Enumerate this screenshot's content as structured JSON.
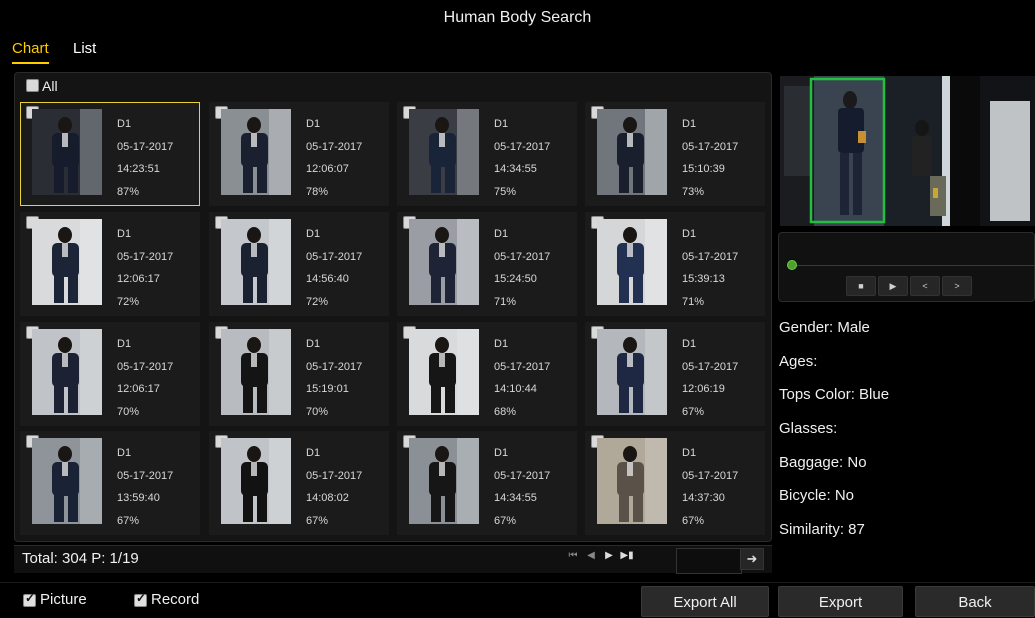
{
  "window": {
    "title": "Human Body Search"
  },
  "tabs": [
    {
      "label": "Chart",
      "active": true
    },
    {
      "label": "List",
      "active": false
    }
  ],
  "grid": {
    "select_all_label": "All",
    "results": [
      {
        "channel": "D1",
        "date": "05-17-2017",
        "time": "14:23:51",
        "score": "87%",
        "selected": true
      },
      {
        "channel": "D1",
        "date": "05-17-2017",
        "time": "12:06:07",
        "score": "78%"
      },
      {
        "channel": "D1",
        "date": "05-17-2017",
        "time": "14:34:55",
        "score": "75%"
      },
      {
        "channel": "D1",
        "date": "05-17-2017",
        "time": "15:10:39",
        "score": "73%"
      },
      {
        "channel": "D1",
        "date": "05-17-2017",
        "time": "12:06:17",
        "score": "72%"
      },
      {
        "channel": "D1",
        "date": "05-17-2017",
        "time": "14:56:40",
        "score": "72%"
      },
      {
        "channel": "D1",
        "date": "05-17-2017",
        "time": "15:24:50",
        "score": "71%"
      },
      {
        "channel": "D1",
        "date": "05-17-2017",
        "time": "15:39:13",
        "score": "71%"
      },
      {
        "channel": "D1",
        "date": "05-17-2017",
        "time": "12:06:17",
        "score": "70%"
      },
      {
        "channel": "D1",
        "date": "05-17-2017",
        "time": "15:19:01",
        "score": "70%"
      },
      {
        "channel": "D1",
        "date": "05-17-2017",
        "time": "14:10:44",
        "score": "68%"
      },
      {
        "channel": "D1",
        "date": "05-17-2017",
        "time": "12:06:19",
        "score": "67%"
      },
      {
        "channel": "D1",
        "date": "05-17-2017",
        "time": "13:59:40",
        "score": "67%"
      },
      {
        "channel": "D1",
        "date": "05-17-2017",
        "time": "14:08:02",
        "score": "67%"
      },
      {
        "channel": "D1",
        "date": "05-17-2017",
        "time": "14:34:55",
        "score": "67%"
      },
      {
        "channel": "D1",
        "date": "05-17-2017",
        "time": "14:37:30",
        "score": "67%"
      }
    ]
  },
  "pagination": {
    "total_text": "Total: 304  P: 1/19",
    "page_input_value": ""
  },
  "details": {
    "attributes": [
      "Gender: Male",
      "Ages:",
      "Tops Color: Blue",
      "Glasses:",
      "Baggage: No",
      "Bicycle: No",
      "Similarity: 87"
    ]
  },
  "footer": {
    "picture_label": "Picture",
    "picture_checked": true,
    "record_label": "Record",
    "record_checked": true,
    "export_all_label": "Export All",
    "export_label": "Export",
    "back_label": "Back"
  },
  "colors": {
    "accent": "#ffcc00",
    "selection_border": "#e6d230",
    "detection_box": "#22c040",
    "background": "#000000"
  },
  "icons": {
    "pager": [
      "first-page-icon",
      "prev-page-icon",
      "next-page-icon",
      "last-page-icon"
    ],
    "go": "arrow-right-icon",
    "player": [
      "stop-icon",
      "play-icon",
      "step-back-icon",
      "step-forward-icon"
    ]
  }
}
